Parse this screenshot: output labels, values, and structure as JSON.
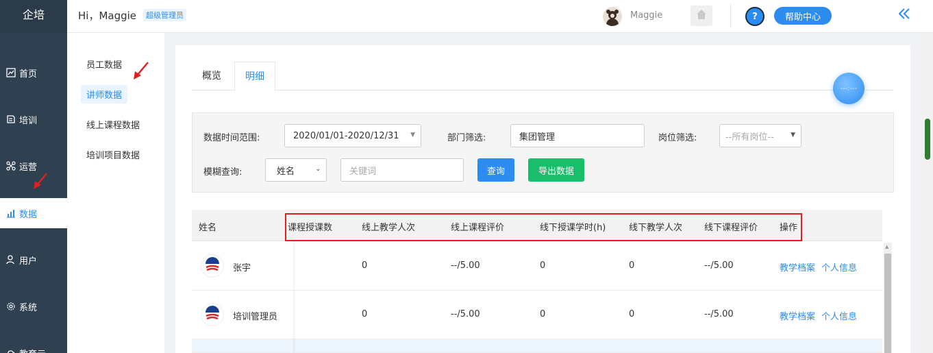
{
  "app": {
    "logo": "企培"
  },
  "nav": {
    "items": [
      {
        "label": "首页",
        "icon": "chart-line-icon"
      },
      {
        "label": "培训",
        "icon": "book-icon"
      },
      {
        "label": "运营",
        "icon": "network-icon"
      },
      {
        "label": "数据",
        "icon": "bar-chart-icon",
        "active": true
      },
      {
        "label": "用户",
        "icon": "user-icon"
      },
      {
        "label": "系统",
        "icon": "gear-icon"
      },
      {
        "label": "教育云",
        "icon": "cloud-icon"
      }
    ]
  },
  "header": {
    "greeting": "Hi，Maggie",
    "role": "超级管理员",
    "user_name": "Maggie",
    "help_label": "帮助中心",
    "help_icon": "?"
  },
  "submenu": {
    "items": [
      {
        "label": "员工数据"
      },
      {
        "label": "讲师数据",
        "active": true
      },
      {
        "label": "线上课程数据"
      },
      {
        "label": "培训项目数据"
      }
    ]
  },
  "tabs": [
    {
      "label": "概览"
    },
    {
      "label": "明细",
      "active": true
    }
  ],
  "floating": {
    "text": "---:---"
  },
  "filters": {
    "date_label": "数据时间范围:",
    "date_value": "2020/01/01-2020/12/31",
    "dept_label": "部门筛选:",
    "dept_value": "集团管理",
    "post_label": "岗位筛选:",
    "post_value": "--所有岗位--",
    "fuzzy_label": "模糊查询:",
    "fuzzy_select": "姓名",
    "keyword_placeholder": "关键词",
    "query_button": "查询",
    "export_button": "导出数据"
  },
  "table": {
    "headers": [
      "姓名",
      "课程授课数",
      "线上教学人次",
      "线上课程评价",
      "线下授课学时(h)",
      "线下教学人次",
      "线下课程评价",
      "操作"
    ],
    "rows": [
      {
        "name": "张宇",
        "online_students": "0",
        "online_rating": "--/5.00",
        "offline_hours": "0",
        "offline_students": "0",
        "offline_rating": "--/5.00",
        "action1": "教学档案",
        "action2": "个人信息"
      },
      {
        "name": "培训管理员",
        "online_students": "0",
        "online_rating": "--/5.00",
        "offline_hours": "0",
        "offline_students": "0",
        "offline_rating": "--/5.00",
        "action1": "教学档案",
        "action2": "个人信息"
      }
    ]
  },
  "colors": {
    "accent": "#2d8cf0",
    "nav_bg": "#2f4050",
    "export_green": "#19be6b",
    "annotation_red": "#e02020"
  }
}
